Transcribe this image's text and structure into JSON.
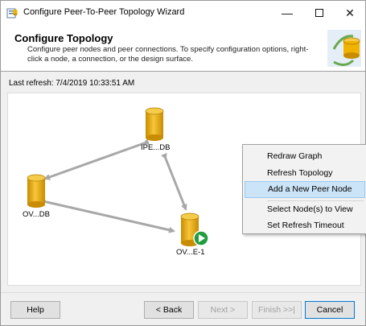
{
  "window": {
    "title": "Configure Peer-To-Peer Topology Wizard",
    "minimize_glyph": "—",
    "close_glyph": "✕"
  },
  "header": {
    "title": "Configure Topology",
    "description": "Configure peer nodes and peer connections. To specify configuration options, right-click a node, a connection, or the design surface."
  },
  "refresh": {
    "text": "Last refresh: 7/4/2019 10:33:51 AM"
  },
  "topology": {
    "nodes": [
      {
        "id": "ipe",
        "label": "IPE...DB"
      },
      {
        "id": "ov_db",
        "label": "OV...DB"
      },
      {
        "id": "ov_e1",
        "label": "OV...E-1",
        "selected": true
      }
    ],
    "connections": [
      [
        "ipe",
        "ov_db"
      ],
      [
        "ipe",
        "ov_e1"
      ],
      [
        "ov_db",
        "ov_e1"
      ]
    ]
  },
  "context_menu": {
    "items": [
      {
        "label": "Redraw Graph"
      },
      {
        "label": "Refresh Topology"
      },
      {
        "label": "Add a New Peer Node",
        "highlighted": true
      },
      {
        "label": "Select Node(s) to View"
      },
      {
        "label": "Set Refresh Timeout"
      }
    ]
  },
  "buttons": {
    "help": "Help",
    "back": "< Back",
    "next": "Next >",
    "finish": "Finish >>|",
    "cancel": "Cancel"
  },
  "colors": {
    "db_gold": "#f0b400",
    "db_gold_dark": "#c98c00",
    "arrow": "#a8a8a8",
    "menu_highlight": "#cce4f7",
    "accent": "#0078d7"
  }
}
